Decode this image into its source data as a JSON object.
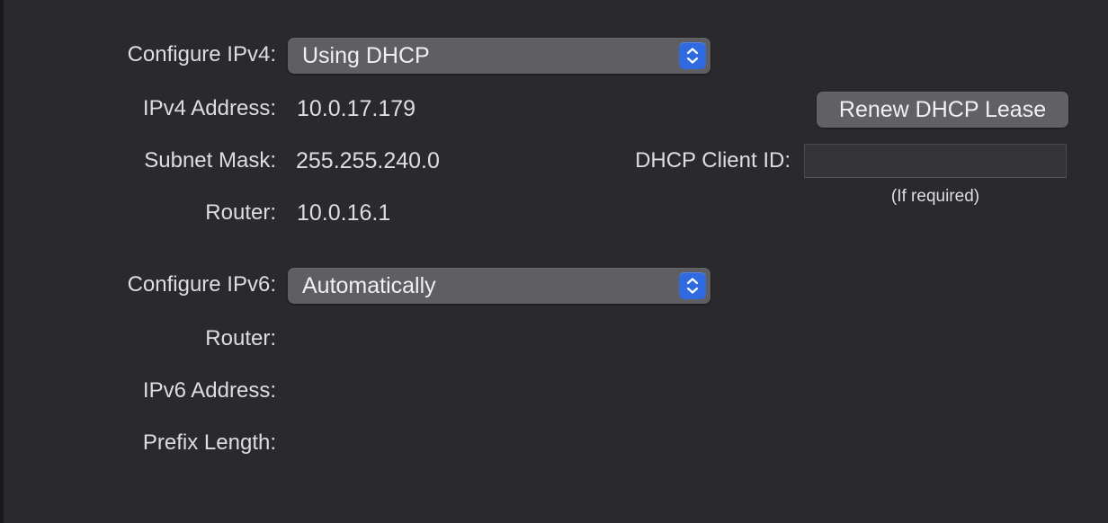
{
  "ipv4": {
    "configure_label": "Configure IPv4:",
    "configure_value": "Using DHCP",
    "address_label": "IPv4 Address:",
    "address_value": "10.0.17.179",
    "subnet_label": "Subnet Mask:",
    "subnet_value": "255.255.240.0",
    "router_label": "Router:",
    "router_value": "10.0.16.1",
    "renew_button_label": "Renew DHCP Lease",
    "client_id_label": "DHCP Client ID:",
    "client_id_value": "",
    "client_id_hint": "(If required)"
  },
  "ipv6": {
    "configure_label": "Configure IPv6:",
    "configure_value": "Automatically",
    "router_label": "Router:",
    "router_value": "",
    "address_label": "IPv6 Address:",
    "address_value": "",
    "prefix_label": "Prefix Length:",
    "prefix_value": ""
  },
  "icons": {
    "popup_stepper": "up-down-chevron-icon"
  },
  "colors": {
    "accent": "#2f6ae0",
    "panel_background": "#2a292d",
    "control_background": "#5f5f62",
    "text": "#dedde1"
  }
}
